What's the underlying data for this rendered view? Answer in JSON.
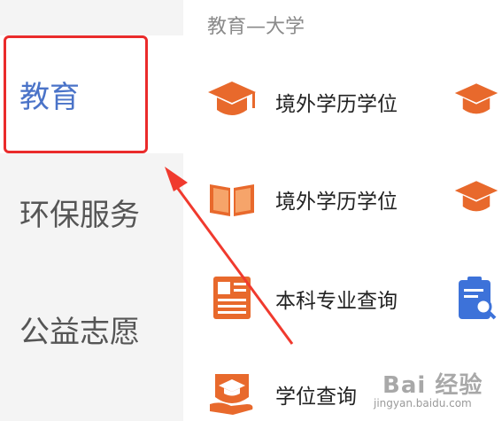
{
  "sidebar": {
    "items": [
      {
        "label": "教育",
        "active": true
      },
      {
        "label": "环保服务",
        "active": false
      },
      {
        "label": "公益志愿",
        "active": false
      }
    ]
  },
  "content": {
    "section_title": "教育—大学",
    "services": [
      {
        "label": "境外学历学位",
        "icon": "graduation-cap-icon",
        "right_icon": "graduation-cap-icon"
      },
      {
        "label": "境外学历学位",
        "icon": "open-book-icon",
        "right_icon": "graduation-cap-icon"
      },
      {
        "label": "本科专业查询",
        "icon": "newspaper-icon",
        "right_icon": "clipboard-search-icon"
      },
      {
        "label": "学位查询",
        "icon": "degree-hand-icon"
      }
    ]
  },
  "watermark": {
    "main": "Bai 经验",
    "sub": "jingyan.baidu.com"
  },
  "colors": {
    "accent_blue": "#4a73c8",
    "icon_orange": "#e8692c",
    "highlight_red": "#ea2b2b",
    "sidebar_bg": "#f4f4f4"
  }
}
